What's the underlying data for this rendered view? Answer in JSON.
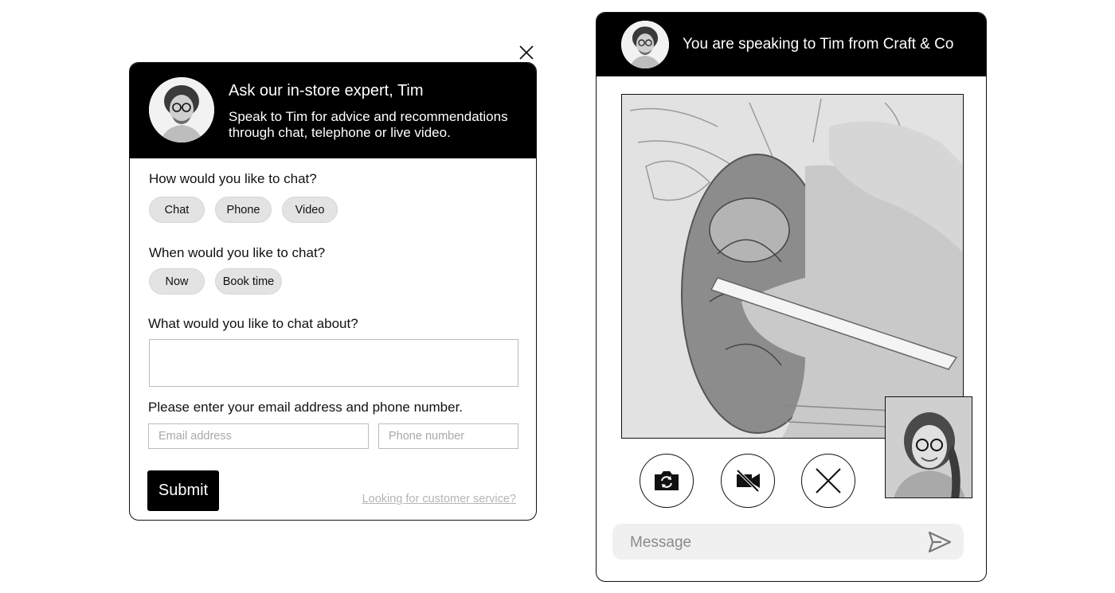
{
  "left_panel": {
    "header": {
      "title": "Ask our in-store expert, Tim",
      "subtitle_line1": "Speak to Tim for advice and recommendations",
      "subtitle_line2": "through chat, telephone or live video."
    },
    "chat_type": {
      "question": "How would you like to chat?",
      "options": [
        "Chat",
        "Phone",
        "Video"
      ]
    },
    "chat_time": {
      "question": "When would you like to chat?",
      "options": [
        "Now",
        "Book time"
      ]
    },
    "topic": {
      "question": "What would you like to chat about?",
      "value": ""
    },
    "contact": {
      "question": "Please enter your email address and phone number.",
      "email_placeholder": "Email address",
      "phone_placeholder": "Phone number"
    },
    "submit_label": "Submit",
    "customer_service_link": "Looking for customer service?"
  },
  "right_panel": {
    "header_title": "You are speaking to Tim from Craft & Co",
    "controls": [
      "camera-switch-icon",
      "video-off-icon",
      "end-call-icon"
    ],
    "message_placeholder": "Message"
  },
  "colors": {
    "header_bg": "#000000",
    "pill_bg": "#e3e3e3",
    "input_border": "#bcbcbc",
    "link_grey": "#b5b5b5",
    "message_bar_bg": "#f0f0f0"
  }
}
